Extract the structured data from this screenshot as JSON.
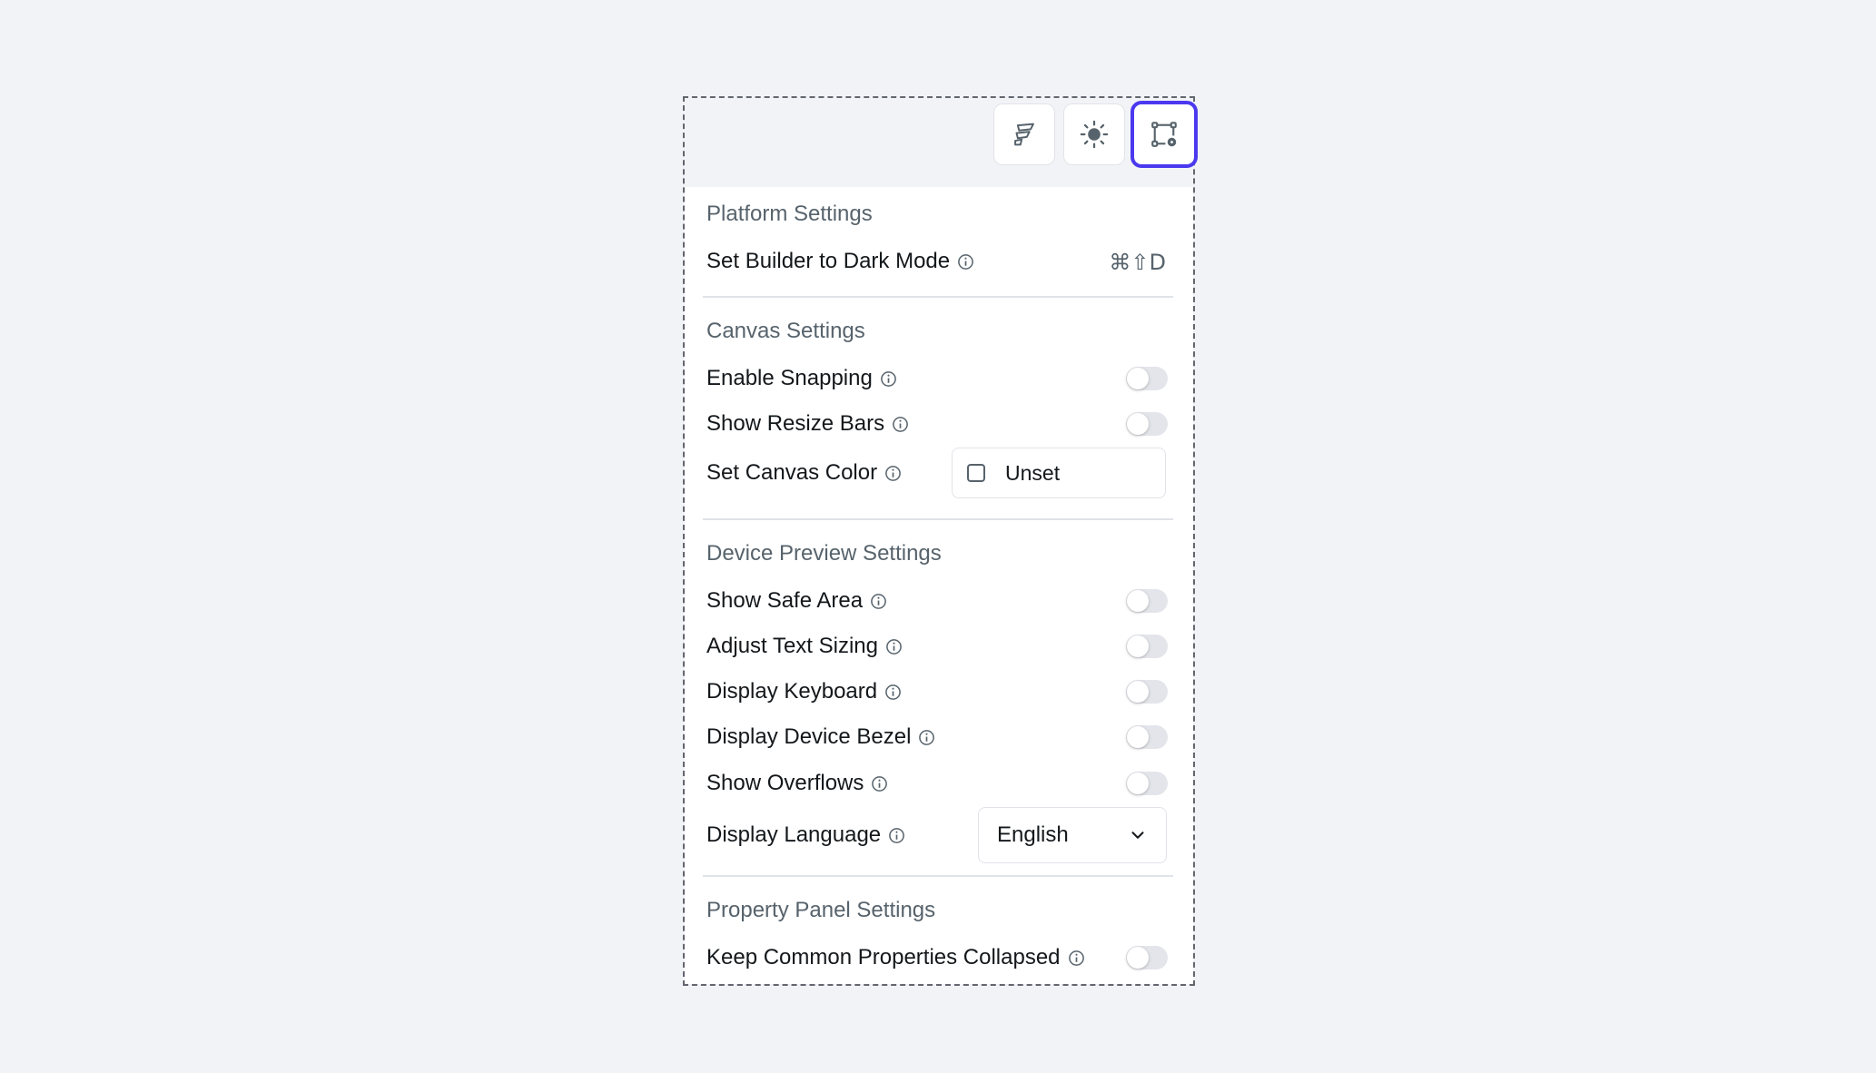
{
  "toolbar": {
    "buttons": [
      {
        "icon": "flutterflow-logo-icon"
      },
      {
        "icon": "sun-icon"
      },
      {
        "icon": "canvas-settings-icon",
        "active": true
      }
    ]
  },
  "sections": {
    "platform": {
      "title": "Platform Settings",
      "dark_mode_label": "Set Builder to Dark Mode",
      "dark_mode_shortcut": "⌘⇧D"
    },
    "canvas": {
      "title": "Canvas Settings",
      "enable_snapping": "Enable Snapping",
      "show_resize_bars": "Show Resize Bars",
      "set_canvas_color": "Set Canvas Color",
      "canvas_color_value": "Unset"
    },
    "device_preview": {
      "title": "Device Preview Settings",
      "show_safe_area": "Show Safe Area",
      "adjust_text_sizing": "Adjust Text Sizing",
      "display_keyboard": "Display Keyboard",
      "display_device_bezel": "Display Device Bezel",
      "show_overflows": "Show Overflows",
      "display_language": "Display Language",
      "display_language_value": "English"
    },
    "property_panel": {
      "title": "Property Panel Settings",
      "keep_collapsed": "Keep Common Properties Collapsed"
    }
  },
  "toggles": {
    "enable_snapping": false,
    "show_resize_bars": false,
    "show_safe_area": false,
    "adjust_text_sizing": false,
    "display_keyboard": false,
    "display_device_bezel": false,
    "show_overflows": false,
    "keep_collapsed": false
  },
  "colors": {
    "accent": "#4b39ef",
    "background": "#f2f3f7",
    "panel": "#ffffff",
    "primary_text": "#14181b",
    "secondary_text": "#57636c",
    "toggle_off": "#e3e5ea"
  }
}
